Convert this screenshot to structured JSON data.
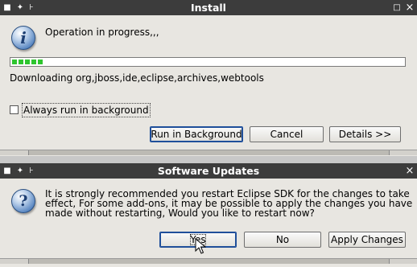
{
  "install_dialog": {
    "title": "Install",
    "pin_icon": "✦",
    "pin2_icon": "⊦",
    "maximize_icon": "□",
    "close_icon": "×",
    "info_icon_glyph": "i",
    "message": "Operation in progress,,,",
    "progress_fraction": 0.08,
    "status": "Downloading org,jboss,ide,eclipse,archives,webtools",
    "checkbox_label": "Always run in background",
    "checkbox_checked": false,
    "buttons": {
      "run_in_background": "Run in Background",
      "cancel": "Cancel",
      "details": "Details >>"
    }
  },
  "updates_dialog": {
    "title": "Software Updates",
    "pin_icon": "✦",
    "pin2_icon": "⊦",
    "close_icon": "×",
    "question_icon_glyph": "?",
    "message_line1": "It is strongly recommended you restart Eclipse SDK for the changes to take",
    "message_line2": "effect, For some add-ons, it may be possible to apply the changes you have",
    "message_line3": "made without restarting, Would you like to restart now?",
    "buttons": {
      "yes": "Yes",
      "no": "No",
      "apply_changes": "Apply Changes"
    }
  },
  "colors": {
    "titlebar": "#3c3c3c",
    "dialog_bg": "#e8e6e1",
    "progress": "#2ec52e"
  }
}
